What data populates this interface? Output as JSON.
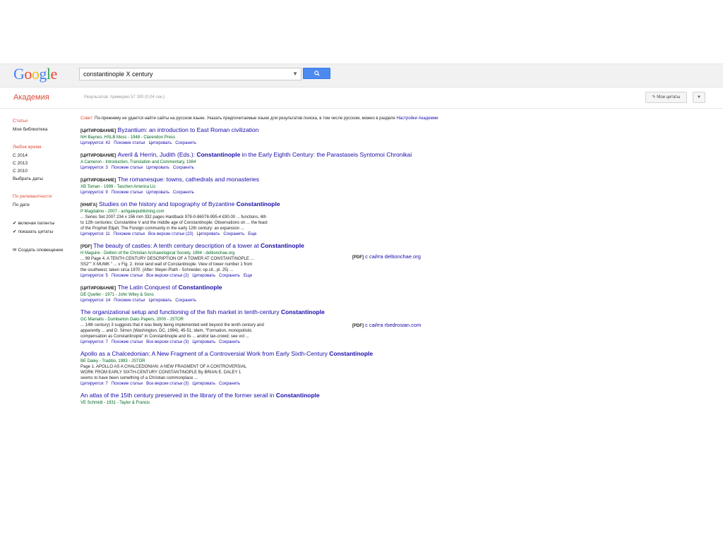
{
  "header": {
    "search_value": "constantinople X century"
  },
  "subheader": {
    "brand": "Академия",
    "stats": "Результатов: примерно 57 300 (0,04 сек.)",
    "my_citations": "Мои цитаты"
  },
  "sidebar": {
    "articles": "Статьи",
    "my_library": "Моя библиотека",
    "any_time": "Любое время",
    "years": [
      "С 2014",
      "С 2013",
      "С 2010"
    ],
    "choose_dates": "Выбрать даты",
    "by_relevance": "По релевантности",
    "by_date": "По дате",
    "include_patents": "включая патенты",
    "include_citations": "показать цитаты",
    "create_alert": "Создать оповещение"
  },
  "notice": {
    "prefix": "Совет:",
    "text": "По-прежнему не удается найти сайты на русском языке. Указать предпочитаемые языки для результатов поиска, в том числе русском, можно в разделе",
    "link": "Настройки Академии"
  },
  "results": [
    {
      "tag": "[ЦИТИРОВАНИЕ]",
      "title_a": "Byzantium: an introduction to East Roman civilization",
      "title_b": "",
      "title_c": "",
      "meta": "NH Baynes, HSLB Moss - 1948 - Clarendon Press",
      "snip1": "",
      "snip2": "",
      "snip3": "",
      "links": [
        "Цитируется: 42",
        "Похожие статьи",
        "Цитировать",
        "Сохранить"
      ]
    },
    {
      "tag": "[ЦИТИРОВАНИЕ]",
      "title_a": "Averil & Herrin, Judith (Eds.): ",
      "title_b": "Constantinople",
      "title_c": " in the Early Eighth Century: the Parastaseis Syntomoi Chronikai",
      "meta": "A Cameron - Introduction, Translation and Commentary, 1984",
      "snip1": "",
      "snip2": "",
      "snip3": "",
      "links": [
        "Цитируется: 3",
        "Похожие статьи",
        "Цитировать",
        "Сохранить"
      ]
    },
    {
      "tag": "[ЦИТИРОВАНИЕ]",
      "title_a": "The romanesque: towns, cathedrals and monasteries",
      "title_b": "",
      "title_c": "",
      "meta": "XB Toman - 1999 - Taschen America Llc",
      "snip1": "",
      "snip2": "",
      "snip3": "",
      "links": [
        "Цитируется: 9",
        "Похожие статьи",
        "Цитировать",
        "Сохранить"
      ]
    },
    {
      "tag": "[КНИГА]",
      "title_a": "Studies on the history and topography of Byzantine ",
      "title_b": "Constantinople",
      "title_c": "",
      "meta": "P Magdalino - 2007 - ashgatepublishing.com",
      "snip1": "... Series Set 2007 234 x 156 mm 332 pages Hardback 978-0-86078-995-4 £90.00 ... functions, 6th",
      "snip2": "to 12th centuries; Constantine V and the middle age of Constantinople; Observations on ... the feast",
      "snip3": "of the Prophet Elijah; The Foreign community in the early 12th century: an expansion ...",
      "links": [
        "Цитируется: 11",
        "Похожие статьи",
        "Все версии статьи (23)",
        "Цитировать",
        "Сохранить",
        "Еще"
      ]
    },
    {
      "tag": "[PDF]",
      "title_a": "The beauty of castles: A tenth century description of a tower at ",
      "title_b": "Constantinople",
      "title_c": "",
      "meta": "H Maguire - Deltion of the Christian Archaeological Society, 1994 - deltionchae.org",
      "snip1": "... 99 Page 4. A TENTH CENTURY DESCRIPTION OF A TOWER AT CONSTANTINOPLE ...",
      "snip2": "SS2\"\" X MUMK \" ... v Fig. 2. Innor land wall of Constantinople. View of tower number 1 from",
      "snip3": "the southwest, taken circa 1970. (After: Meyer-Plath - Schneider, op.cit., pl. 25) ...",
      "links": [
        "Цитируется: 5",
        "Похожие статьи",
        "Все версии статьи (2)",
        "Цитировать",
        "Сохранить",
        "Еще"
      ]
    },
    {
      "tag": "[ЦИТИРОВАНИЕ]",
      "title_a": "The Latin Conquest of ",
      "title_b": "Constantinople",
      "title_c": "",
      "meta": "DE Queller - 1971 - John Wiley & Sons",
      "snip1": "",
      "snip2": "",
      "snip3": "",
      "links": [
        "Цитируется: 14",
        "Похожие статьи",
        "Цитировать",
        "Сохранить"
      ]
    },
    {
      "tag": "",
      "title_a": "The organizational setup and functioning of the fish market in tenth-century ",
      "title_b": "Constantinople",
      "title_c": "",
      "meta": "GC Maniatis - Dumbarton Oaks Papers, 2000 - JSTOR",
      "snip1": "... 14th century) 3 suggests that it was likely being implemented well beyond the tenth century and",
      "snip2": "apparently ... and D. Simon (Washington, DC, 1994), 45-51; idem, \"Formation, monopolistic",
      "snip3": "compensation as Constantinople\" in Constantinople and its ... and/or tax-crowd; see vol ...",
      "links": [
        "Цитируется: 7",
        "Похожие статьи",
        "Все версии статьи (3)",
        "Цитировать",
        "Сохранить"
      ]
    },
    {
      "tag": "",
      "title_a": "Apollo as a Chalcedonian: A New Fragment of a Controversial Work from Early Sixth-Century ",
      "title_b": "Constantinople",
      "title_c": "",
      "meta": "BE Daley - Traditio, 1993 - JSTOR",
      "snip1": "Page 1. APOLLO AS A CHALCEDONIAN: A NEW FRAGMENT OF A CONTROVERSIAL",
      "snip2": "WORK FROM EARLY SIXTH-CENTURY CONSTANTINOPLE By BRIAN E. DALEY 1",
      "snip3": "seems to have been something of a Christian commonplace ...",
      "links": [
        "Цитируется: 7",
        "Похожие статьи",
        "Все версии статьи (3)",
        "Цитировать",
        "Сохранить"
      ]
    },
    {
      "tag": "",
      "title_a": "An atlas of the 15th century preserved in the library of the former serail in ",
      "title_b": "Constantinople",
      "title_c": "",
      "meta": "VE Schmidt - 1931 - Taylor & Francis",
      "snip1": "",
      "snip2": "",
      "snip3": "",
      "links": []
    }
  ],
  "pdf_links": [
    {
      "tag": "[PDF]",
      "text": "с сайта deltionchae.org"
    },
    {
      "tag": "[PDF]",
      "text": "с сайта rbedrosian.com"
    }
  ]
}
